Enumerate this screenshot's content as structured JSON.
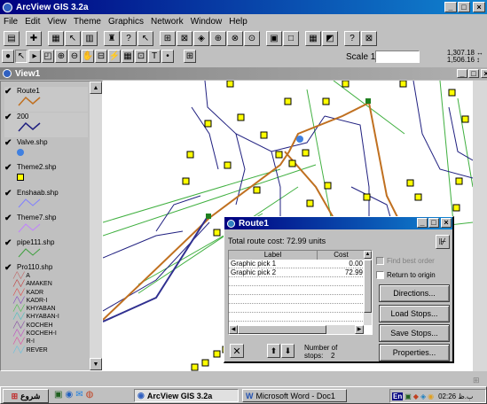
{
  "app": {
    "title": "ArcView GIS 3.2a"
  },
  "menu": [
    "File",
    "Edit",
    "View",
    "Theme",
    "Graphics",
    "Network",
    "Window",
    "Help"
  ],
  "scale": {
    "label": "Scale 1:",
    "value": "",
    "coord_x": "1,307.18",
    "coord_y": "1,506.16"
  },
  "view": {
    "title": "View1"
  },
  "legend": [
    {
      "name": "Route1",
      "color": "#c07020"
    },
    {
      "name": "200",
      "color": "#202080"
    },
    {
      "name": "Valve.shp",
      "color": "#4080e0"
    },
    {
      "name": "Theme2.shp",
      "color": "#ffff00"
    },
    {
      "name": "Enshaab.shp",
      "color": "#8080ff"
    },
    {
      "name": "Theme7.shp",
      "color": "#c080ff"
    },
    {
      "name": "pipe111.shp",
      "color": "#40a040"
    },
    {
      "name": "Pro110.shp",
      "color": "#000000"
    }
  ],
  "pro110_classes": [
    "A",
    "AMAKEN",
    "KADR",
    "KADR-I",
    "KHYABAN",
    "KHYABAN-I",
    "KOCHEH",
    "KOCHEH-I",
    "R-I",
    "REVER"
  ],
  "route_dialog": {
    "title": "Route1",
    "cost_text": "Total route cost: 72.99 units",
    "col_label": "Label",
    "col_cost": "Cost",
    "rows": [
      {
        "label": "Graphic pick 1",
        "cost": "0.00"
      },
      {
        "label": "Graphic pick 2",
        "cost": "72.99"
      }
    ],
    "find_best_order": "Find best order",
    "return_to_origin": "Return to origin",
    "buttons": {
      "directions": "Directions...",
      "load": "Load Stops...",
      "save": "Save Stops...",
      "properties": "Properties..."
    },
    "stops_label": "Number of stops:",
    "stops_value": "2"
  },
  "taskbar": {
    "start": "شروع",
    "tasks": [
      "ArcView GIS 3.2a",
      "Microsoft Word - Doc1"
    ],
    "tray_lang": "En",
    "clock": "02:26 ب.ظ"
  }
}
